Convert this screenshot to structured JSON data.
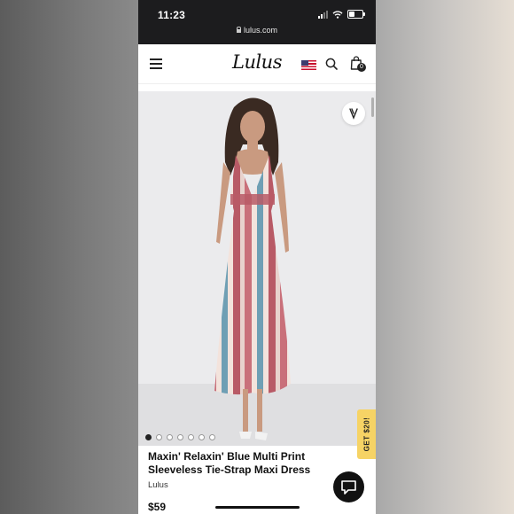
{
  "status_bar": {
    "time": "11:23"
  },
  "browser": {
    "url": "lulus.com"
  },
  "header": {
    "logo": "Lulus",
    "cart_count": "0",
    "menu_icon": "hamburger-icon",
    "region_icon": "us-flag-icon",
    "search_icon": "search-icon",
    "bag_icon": "shopping-bag-icon"
  },
  "product": {
    "title": "Maxin' Relaxin' Blue Multi Print Sleeveless Tie-Strap Maxi Dress",
    "brand": "Lulus",
    "price": "$59",
    "image_count": 7,
    "active_image": 1,
    "image_description": "Model wearing multi print maxi dress"
  },
  "promo": {
    "label": "GET $20!"
  },
  "colors": {
    "status_bar": "#1c1c1e",
    "promo": "#f6d365",
    "text": "#111111",
    "dress_pink": "#c9707a",
    "dress_blue": "#6f9fb4",
    "dress_cream": "#f3e3dc"
  }
}
